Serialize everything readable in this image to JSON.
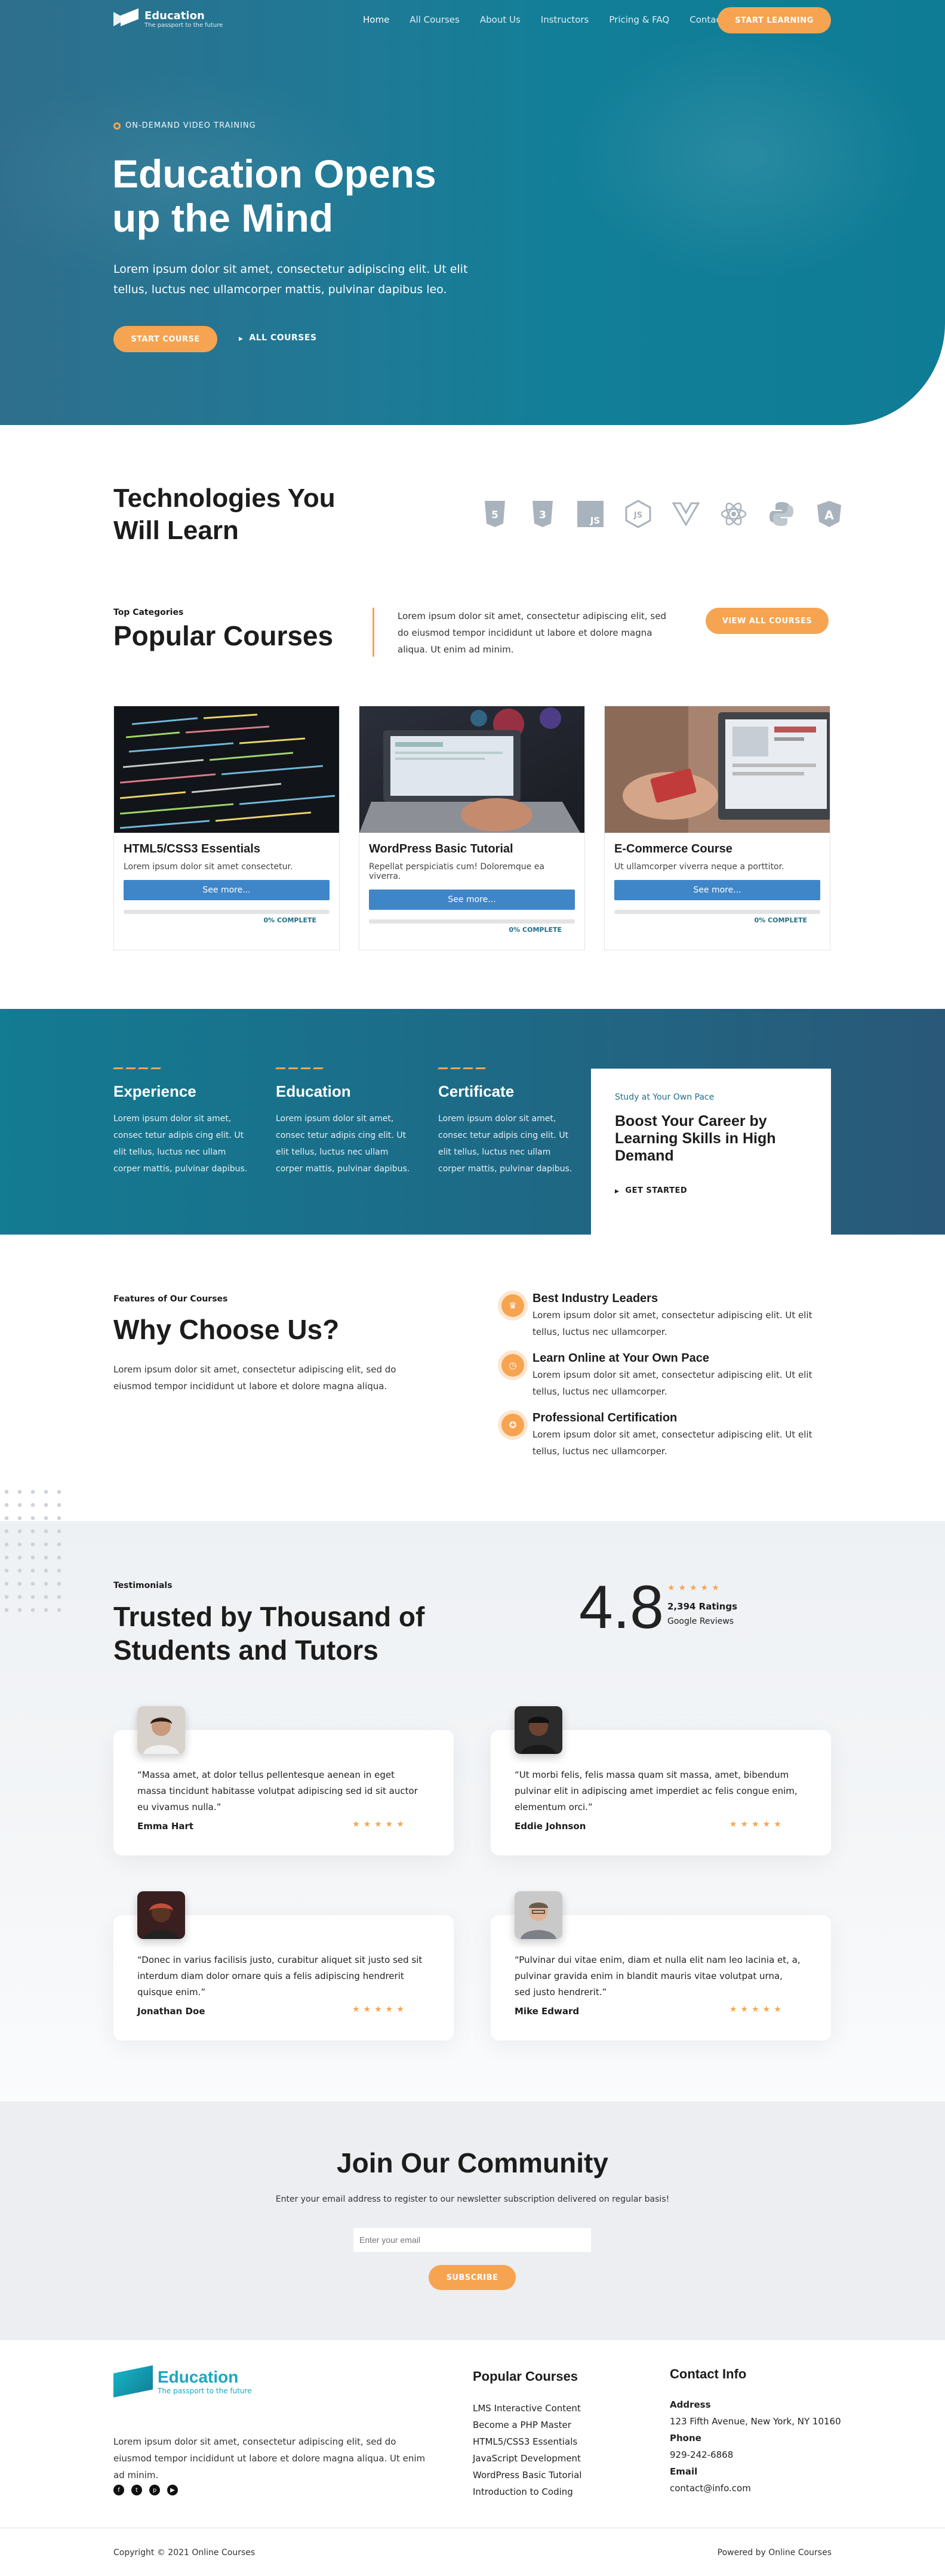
{
  "header": {
    "logo_title": "Education",
    "logo_subtitle": "The passport to the future",
    "nav": [
      "Home",
      "All Courses",
      "About Us",
      "Instructors",
      "Pricing & FAQ",
      "Contact"
    ],
    "cta": "START LEARNING"
  },
  "hero": {
    "eyebrow": "ON-DEMAND VIDEO TRAINING",
    "title": "Education Opens up the Mind",
    "text": "Lorem ipsum dolor sit amet, consectetur adipiscing elit. Ut elit tellus, luctus nec ullamcorper mattis, pulvinar dapibus leo.",
    "primary_button": "START COURSE",
    "secondary_link": "ALL COURSES"
  },
  "technologies": {
    "title": "Technologies You Will Learn",
    "icons": [
      "html5-icon",
      "css3-icon",
      "js-icon",
      "nodejs-icon",
      "vue-icon",
      "react-icon",
      "python-icon",
      "angular-icon"
    ]
  },
  "popular": {
    "eyebrow": "Top Categories",
    "title": "Popular Courses",
    "text": "Lorem ipsum dolor sit amet, consectetur adipiscing elit, sed do eiusmod tempor incididunt ut labore et dolore magna aliqua. Ut enim ad minim.",
    "button": "VIEW ALL COURSES",
    "courses": [
      {
        "title": "HTML5/CSS3 Essentials",
        "desc": "Lorem ipsum dolor sit amet consectetur.",
        "button": "See more...",
        "status": "0% COMPLETE",
        "progress": 0
      },
      {
        "title": "WordPress Basic Tutorial",
        "desc": "Repellat perspiciatis cum! Doloremque ea viverra.",
        "button": "See more...",
        "status": "0% COMPLETE",
        "progress": 0
      },
      {
        "title": "E-Commerce Course",
        "desc": "Ut ullamcorper viverra neque a porttitor.",
        "button": "See more...",
        "status": "0% COMPLETE",
        "progress": 0
      }
    ]
  },
  "features": {
    "items": [
      {
        "title": "Experience",
        "text": "Lorem ipsum dolor sit amet, consec tetur adipis cing elit. Ut elit tellus, luctus nec ullam corper mattis, pulvinar dapibus."
      },
      {
        "title": "Education",
        "text": "Lorem ipsum dolor sit amet, consec tetur adipis cing elit. Ut elit tellus, luctus nec ullam corper mattis, pulvinar dapibus."
      },
      {
        "title": "Certificate",
        "text": "Lorem ipsum dolor sit amet, consec tetur adipis cing elit. Ut elit tellus, luctus nec ullam corper mattis, pulvinar dapibus."
      }
    ],
    "pace_eyebrow": "Study at Your Own Pace",
    "pace_title": "Boost Your Career by Learning Skills in High Demand",
    "pace_link": "GET STARTED"
  },
  "why": {
    "eyebrow": "Features of Our Courses",
    "title": "Why Choose Us?",
    "text": "Lorem ipsum dolor sit amet, consectetur adipiscing elit, sed do eiusmod tempor incididunt ut labore et dolore magna aliqua.",
    "items": [
      {
        "title": "Best Industry Leaders",
        "text": "Lorem ipsum dolor sit amet, consectetur adipiscing elit. Ut elit tellus, luctus nec ullamcorper."
      },
      {
        "title": "Learn Online at Your Own Pace",
        "text": "Lorem ipsum dolor sit amet, consectetur adipiscing elit. Ut elit tellus, luctus nec ullamcorper."
      },
      {
        "title": "Professional Certification",
        "text": "Lorem ipsum dolor sit amet, consectetur adipiscing elit. Ut elit tellus, luctus nec ullamcorper."
      }
    ]
  },
  "testimonials": {
    "eyebrow": "Testimonials",
    "title": "Trusted by Thousand of Students and Tutors",
    "rating": "4.8",
    "stars": "★★★★★",
    "rating_count": "2,394 Ratings",
    "rating_source": "Google Reviews",
    "items": [
      {
        "text": "“Massa amet, at dolor tellus pellentesque aenean in eget massa tincidunt habitasse volutpat adipiscing sed id sit auctor eu vivamus nulla.”",
        "name": "Emma Hart"
      },
      {
        "text": "“Ut morbi felis, felis massa quam sit massa, amet, bibendum pulvinar elit in adipiscing amet imperdiet ac felis congue enim, elementum orci.”",
        "name": "Eddie Johnson"
      },
      {
        "text": "“Donec in varius facilisis justo, curabitur aliquet sit justo sed sit interdum diam dolor ornare quis a felis adipiscing hendrerit quisque enim.”",
        "name": "Jonathan Doe"
      },
      {
        "text": "“Pulvinar dui vitae enim, diam et nulla elit nam leo lacinia et, a, pulvinar gravida enim in blandit mauris vitae volutpat urna, sed justo hendrerit.”",
        "name": "Mike Edward"
      }
    ]
  },
  "community": {
    "title": "Join Our Community",
    "text": "Enter your email address to register to our newsletter subscription delivered on regular basis!",
    "placeholder": "Enter your email",
    "button": "SUBSCRIBE"
  },
  "footer": {
    "logo_title": "Education",
    "logo_subtitle": "The passport to the future",
    "text": "Lorem ipsum dolor sit amet, consectetur adipiscing elit, sed do eiusmod tempor incididunt ut labore et dolore magna aliqua. Ut enim ad minim.",
    "socials": [
      "facebook-icon",
      "twitter-icon",
      "pinterest-icon",
      "youtube-icon"
    ],
    "courses_title": "Popular Courses",
    "courses": [
      "LMS Interactive Content",
      "Become a PHP Master",
      "HTML5/CSS3 Essentials",
      "JavaScript Development",
      "WordPress Basic Tutorial",
      "Introduction to Coding"
    ],
    "contact_title": "Contact Info",
    "address_label": "Address",
    "address": "123 Fifth Avenue, New York, NY 10160",
    "phone_label": "Phone",
    "phone": "929-242-6868",
    "email_label": "Email",
    "email": "contact@info.com",
    "copyright": "Copyright © 2021 Online Courses",
    "powered": "Powered by Online Courses"
  },
  "colors": {
    "accent": "#f6a451",
    "primary": "#137b92",
    "button_blue": "#3f86c9"
  }
}
